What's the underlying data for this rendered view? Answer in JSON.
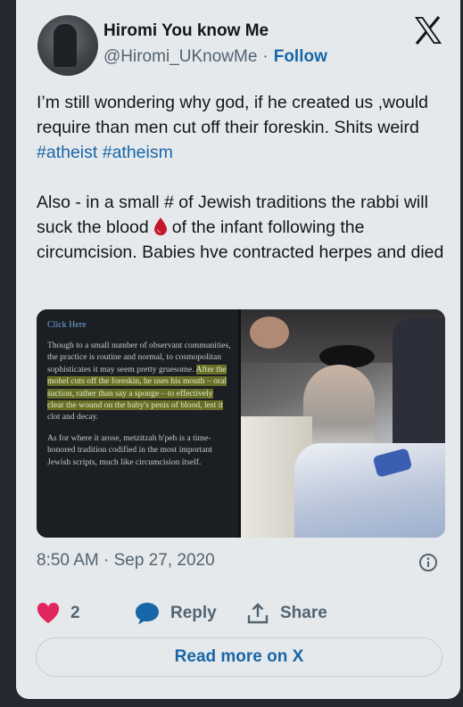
{
  "tweet": {
    "author_name": "Hiromi You know Me",
    "handle": "@Hiromi_UKnowMe",
    "separator": "·",
    "follow_label": "Follow",
    "line1": "I’m still wondering why god, if he created us ,would require than men cut off their foreskin. Shits weird ",
    "hashtag1": "#atheist",
    "hashtag2": "#atheism",
    "line2a": "Also - in a small # of Jewish traditions the rabbi will suck the blood",
    "emoji": "drop-of-blood-icon",
    "line2b": "of the infant following the circumcision. Babies hve contracted herpes and died",
    "timestamp": "8:50 AM · Sep 27, 2020",
    "like_count": "2",
    "reply_label": "Reply",
    "share_label": "Share",
    "read_more_label": "Read more on X"
  },
  "media": {
    "click_here": "Click Here",
    "para1_pre": "Though to a small number of observant communities, the practice is routine and normal, to cosmopolitan sophisticates it may seem pretty gruesome. ",
    "para1_hl": "After the mohel cuts off the foreskin, he uses his mouth – oral suction, rather than say a sponge – to effectively clear the wound on the baby's penis of blood, lest it",
    "para1_post": " clot and decay.",
    "para2": "As for where it arose, metzitzah b'peh is a time-honored tradition codified in the most important Jewish scripts, much like circumcision itself."
  },
  "colors": {
    "link_blue": "#1767a8",
    "heart_pink": "#e0245e",
    "card_bg": "#e6e9ec",
    "page_bg": "#23292f"
  }
}
